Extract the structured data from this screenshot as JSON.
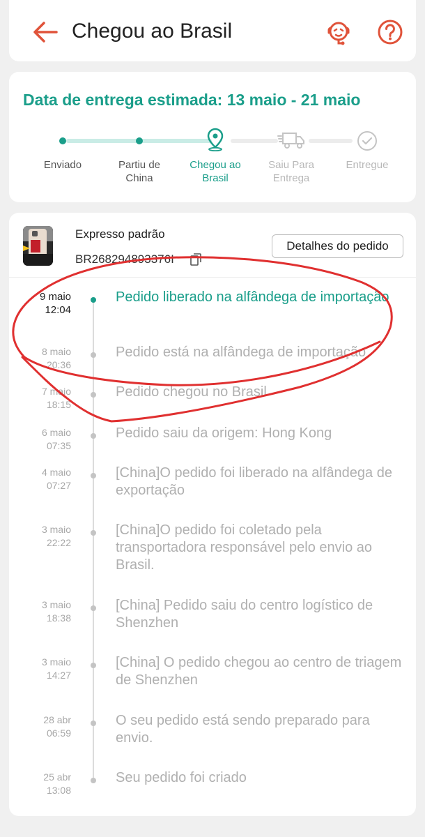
{
  "header": {
    "title": "Chegou ao Brasil",
    "back_icon": "arrow-left-icon",
    "support_icon": "customer-support-icon",
    "help_icon": "question-mark-icon",
    "accent_color": "#e0533a"
  },
  "delivery": {
    "estimate_text": "Data de entrega estimada: 13 maio - 21 maio",
    "steps": [
      {
        "label": "Enviado",
        "state": "done"
      },
      {
        "label": "Partiu de China",
        "state": "done"
      },
      {
        "label": "Chegou ao Brasil",
        "state": "current"
      },
      {
        "label": "Saiu Para Entrega",
        "state": "pending"
      },
      {
        "label": "Entregue",
        "state": "pending"
      }
    ],
    "accent_color": "#1a9e8a"
  },
  "shipment": {
    "method": "Expresso padrão",
    "tracking_number": "BR268294893376I",
    "details_button": "Detalhes do pedido"
  },
  "events": [
    {
      "date": "9 maio",
      "time": "12:04",
      "text": "Pedido liberado na alfândega de importação",
      "current": true
    },
    {
      "date": "8 maio",
      "time": "20:36",
      "text": "Pedido está na alfândega de importação"
    },
    {
      "date": "7 maio",
      "time": "18:15",
      "text": "Pedido chegou no Brasil"
    },
    {
      "date": "6 maio",
      "time": "07:35",
      "text": "Pedido saiu da origem: Hong Kong"
    },
    {
      "date": "4 maio",
      "time": "07:27",
      "text": "[China]O pedido foi liberado na alfândega de exportação"
    },
    {
      "date": "3 maio",
      "time": "22:22",
      "text": "[China]O pedido foi coletado pela transportadora responsável pelo envio ao Brasil."
    },
    {
      "date": "3 maio",
      "time": "18:38",
      "text": "[China] Pedido saiu do centro logístico de Shenzhen"
    },
    {
      "date": "3 maio",
      "time": "14:27",
      "text": "[China] O pedido chegou ao centro de triagem de Shenzhen"
    },
    {
      "date": "28 abr",
      "time": "06:59",
      "text": "O seu pedido está sendo preparado para envio."
    },
    {
      "date": "25 abr",
      "time": "13:08",
      "text": "Seu pedido foi criado"
    }
  ]
}
